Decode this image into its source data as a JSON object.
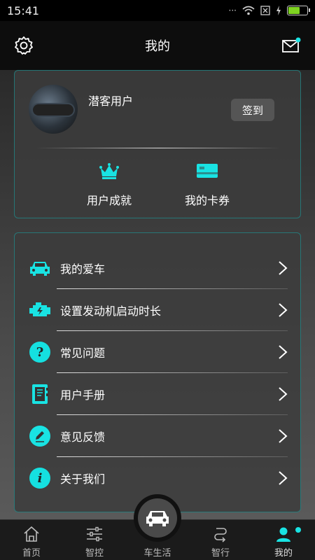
{
  "status_bar": {
    "time": "15:41"
  },
  "header": {
    "title": "我的"
  },
  "profile": {
    "username": "潜客用户",
    "signin_label": "签到"
  },
  "quick_actions": [
    {
      "label": "用户成就",
      "icon": "crown-icon"
    },
    {
      "label": "我的卡券",
      "icon": "card-icon"
    }
  ],
  "menu": [
    {
      "label": "我的爱车",
      "icon": "car-icon"
    },
    {
      "label": "设置发动机启动时长",
      "icon": "engine-icon"
    },
    {
      "label": "常见问题",
      "icon": "question-icon",
      "glyph": "?"
    },
    {
      "label": "用户手册",
      "icon": "manual-icon"
    },
    {
      "label": "意见反馈",
      "icon": "feedback-icon"
    },
    {
      "label": "关于我们",
      "icon": "info-icon",
      "glyph": "i"
    }
  ],
  "tabs": [
    {
      "label": "首页",
      "icon": "home-icon"
    },
    {
      "label": "智控",
      "icon": "sliders-icon"
    },
    {
      "label": "车生活",
      "icon": "car-life-icon"
    },
    {
      "label": "智行",
      "icon": "route-icon"
    },
    {
      "label": "我的",
      "icon": "user-icon",
      "active": true
    }
  ],
  "colors": {
    "accent": "#19e3e3",
    "battery": "#7ed321"
  }
}
